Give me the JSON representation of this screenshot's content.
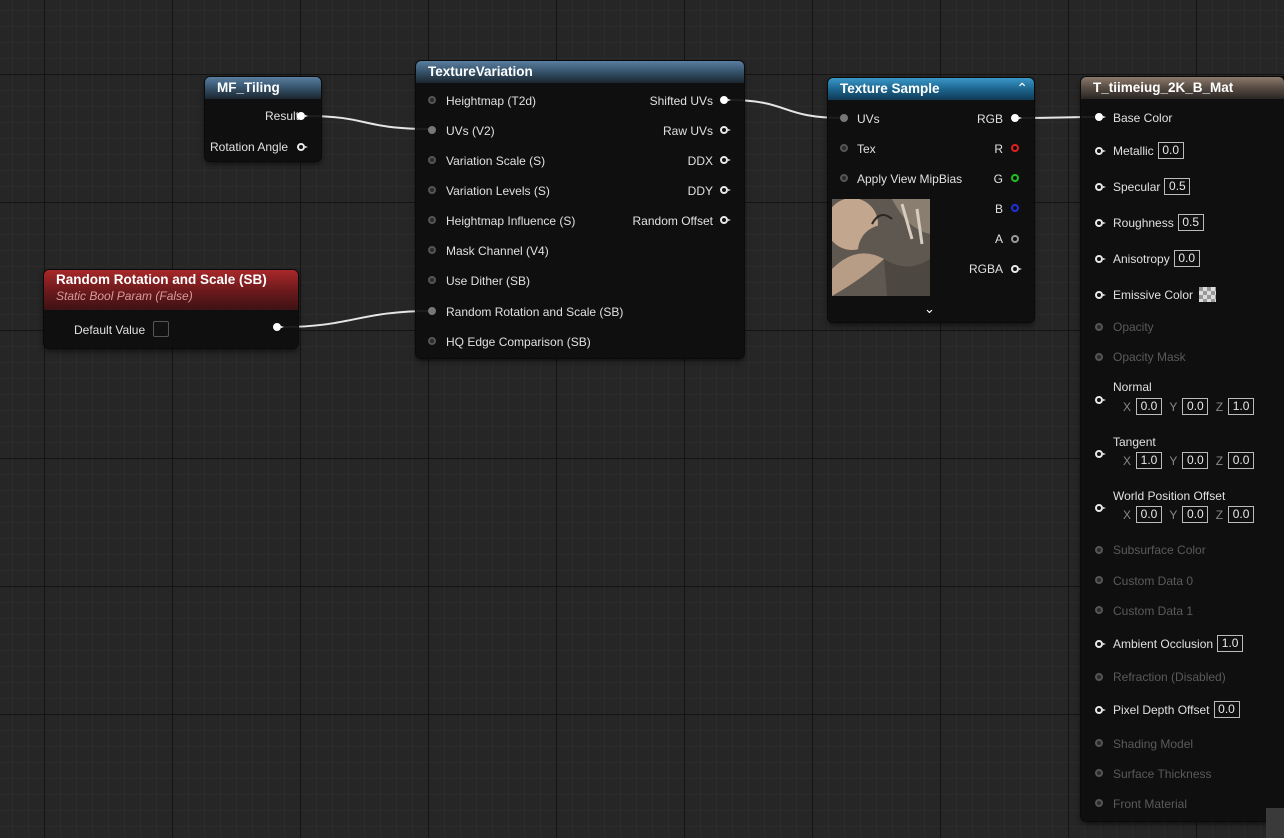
{
  "mf_tiling": {
    "title": "MF_Tiling",
    "outputs": [
      "Result",
      "Rotation Angle"
    ]
  },
  "random_rotation_node": {
    "title": "Random Rotation and Scale (SB)",
    "subtitle": "Static Bool Param (False)",
    "default_value_label": "Default Value"
  },
  "texture_variation": {
    "title": "TextureVariation",
    "inputs": [
      "Heightmap (T2d)",
      "UVs (V2)",
      "Variation Scale (S)",
      "Variation Levels (S)",
      "Heightmap Influence (S)",
      "Mask Channel (V4)",
      "Use Dither (SB)",
      "Random Rotation and Scale (SB)",
      "HQ Edge Comparison (SB)"
    ],
    "outputs": [
      "Shifted UVs",
      "Raw UVs",
      "DDX",
      "DDY",
      "Random Offset"
    ]
  },
  "texture_sample": {
    "title": "Texture Sample",
    "inputs": [
      "UVs",
      "Tex",
      "Apply View MipBias"
    ],
    "outputs": [
      "RGB",
      "R",
      "G",
      "B",
      "A",
      "RGBA"
    ],
    "channel_colors": {
      "R": "#e02020",
      "G": "#20c020",
      "B": "#2030e0",
      "A": "#9a9a9a"
    }
  },
  "material": {
    "title": "T_tiimeiug_2K_B_Mat",
    "base_color": "Base Color",
    "metallic": {
      "label": "Metallic",
      "value": "0.0"
    },
    "specular": {
      "label": "Specular",
      "value": "0.5"
    },
    "roughness": {
      "label": "Roughness",
      "value": "0.5"
    },
    "anisotropy": {
      "label": "Anisotropy",
      "value": "0.0"
    },
    "emissive": "Emissive Color",
    "opacity": "Opacity",
    "opacity_mask": "Opacity Mask",
    "normal": {
      "label": "Normal",
      "x": "0.0",
      "y": "0.0",
      "z": "1.0"
    },
    "tangent": {
      "label": "Tangent",
      "x": "1.0",
      "y": "0.0",
      "z": "0.0"
    },
    "wpo": {
      "label": "World Position Offset",
      "x": "0.0",
      "y": "0.0",
      "z": "0.0"
    },
    "axis_x": "X",
    "axis_y": "Y",
    "axis_z": "Z",
    "subsurface": "Subsurface Color",
    "custom0": "Custom Data 0",
    "custom1": "Custom Data 1",
    "ao": {
      "label": "Ambient Occlusion",
      "value": "1.0"
    },
    "refraction": "Refraction (Disabled)",
    "pdo": {
      "label": "Pixel Depth Offset",
      "value": "0.0"
    },
    "shading_model": "Shading Model",
    "surface_thickness": "Surface Thickness",
    "front_material": "Front Material"
  },
  "colors": {
    "graph_bg": "#262626",
    "wire": "#ffffff",
    "header_function": "#38566f",
    "header_texture": "#1f6b95",
    "header_material": "#5b4f46",
    "header_param": "#6e1a1c"
  }
}
